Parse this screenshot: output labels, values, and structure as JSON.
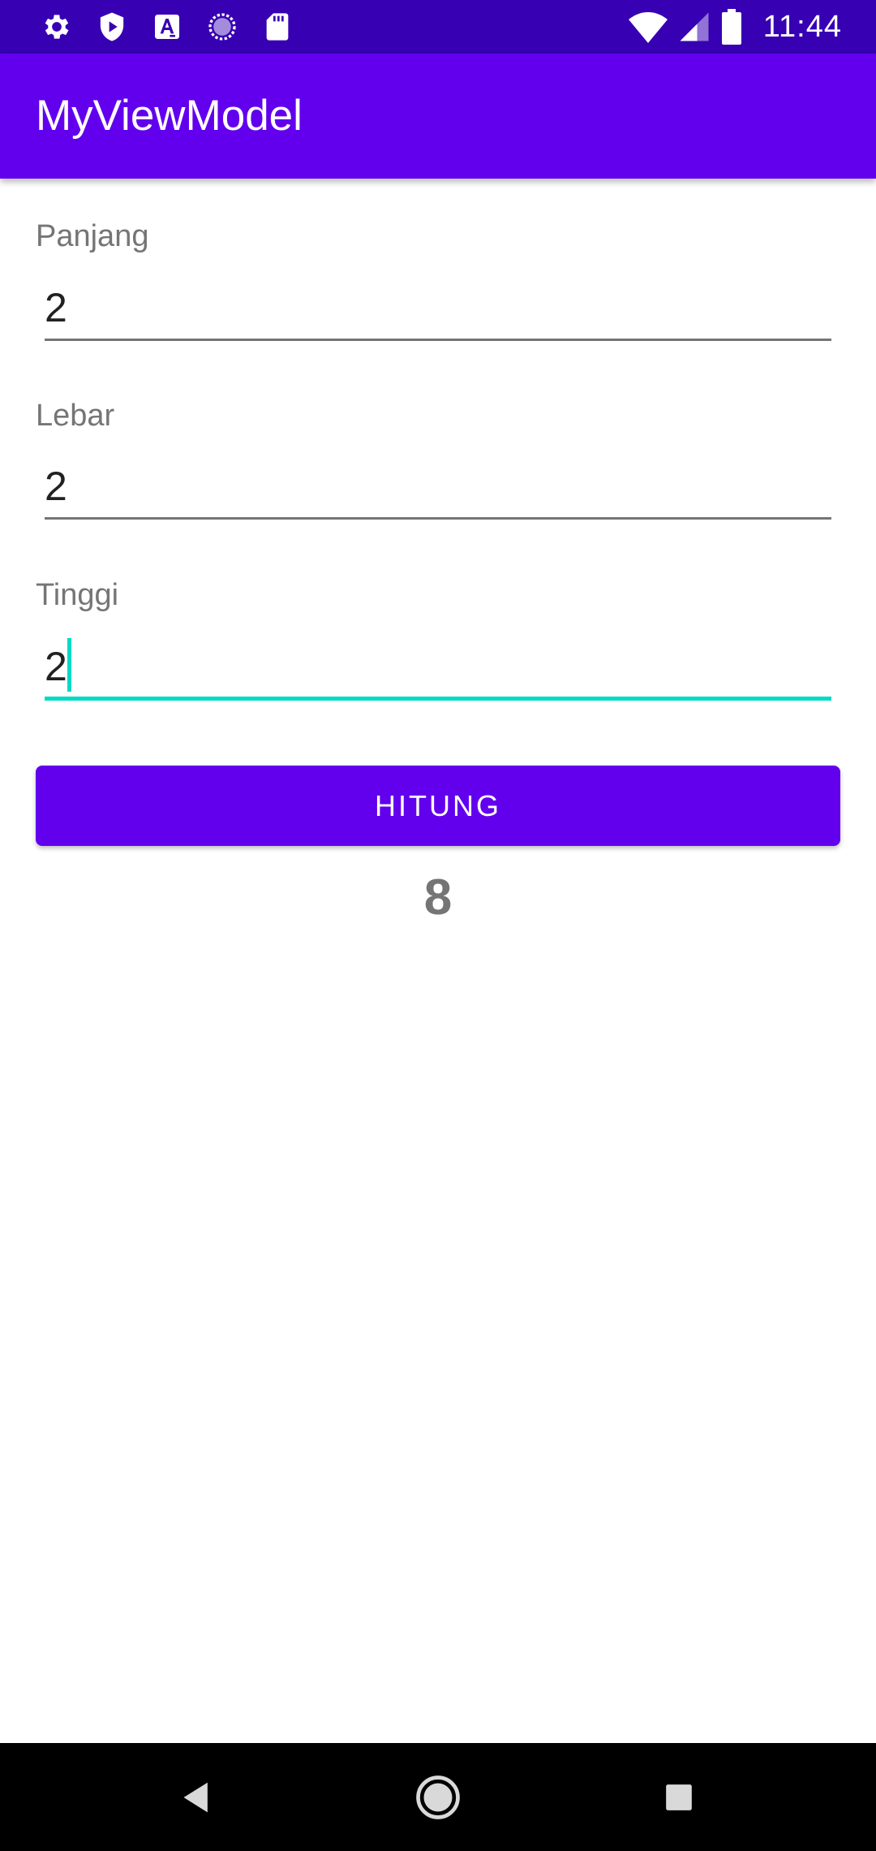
{
  "status_bar": {
    "time": "11:44",
    "left_icons": [
      "gear-icon",
      "shield-play-icon",
      "font-a-icon",
      "circle-progress-icon",
      "sd-card-icon"
    ],
    "right_icons": [
      "wifi-icon",
      "signal-icon",
      "battery-icon"
    ]
  },
  "app_bar": {
    "title": "MyViewModel",
    "color": "#6200ee",
    "status_color": "#3700b3"
  },
  "form": {
    "panjang": {
      "label": "Panjang",
      "value": "2"
    },
    "lebar": {
      "label": "Lebar",
      "value": "2"
    },
    "tinggi": {
      "label": "Tinggi",
      "value": "2"
    },
    "accent_color": "#03dac5"
  },
  "button": {
    "label": "HITUNG"
  },
  "result": {
    "value": "8"
  },
  "nav_bar": {
    "icons": [
      "back-icon",
      "home-icon",
      "recents-icon"
    ]
  }
}
